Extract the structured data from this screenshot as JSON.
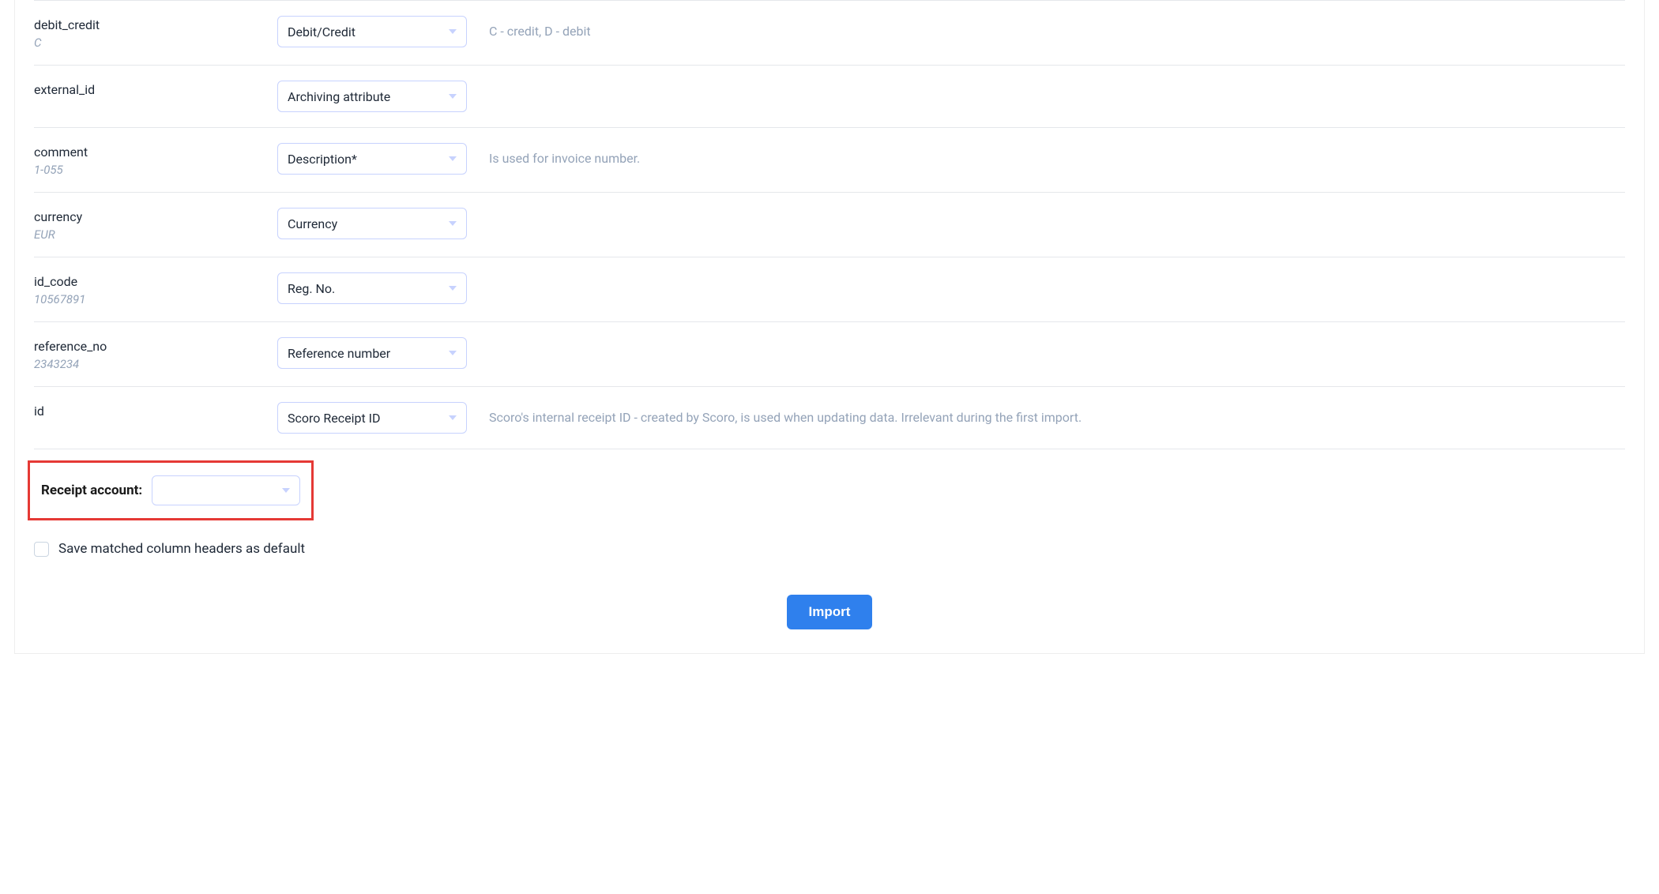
{
  "rows": {
    "debit_credit": {
      "label": "debit_credit",
      "sample": "C",
      "select_value": "Debit/Credit",
      "hint": "C - credit, D - debit"
    },
    "external_id": {
      "label": "external_id",
      "sample": "",
      "select_value": "Archiving attribute",
      "hint": ""
    },
    "comment": {
      "label": "comment",
      "sample": "1-055",
      "select_value": "Description*",
      "hint": "Is used for invoice number."
    },
    "currency": {
      "label": "currency",
      "sample": "EUR",
      "select_value": "Currency",
      "hint": ""
    },
    "id_code": {
      "label": "id_code",
      "sample": "10567891",
      "select_value": "Reg. No.",
      "hint": ""
    },
    "reference_no": {
      "label": "reference_no",
      "sample": "2343234",
      "select_value": "Reference number",
      "hint": ""
    },
    "id": {
      "label": "id",
      "sample": "",
      "select_value": "Scoro Receipt ID",
      "hint": "Scoro's internal receipt ID - created by Scoro, is used when updating data. Irrelevant during the first import."
    }
  },
  "receipt_account": {
    "label": "Receipt account:",
    "select_value": ""
  },
  "save_default": {
    "label": "Save matched column headers as default",
    "checked": false
  },
  "buttons": {
    "import_label": "Import"
  }
}
